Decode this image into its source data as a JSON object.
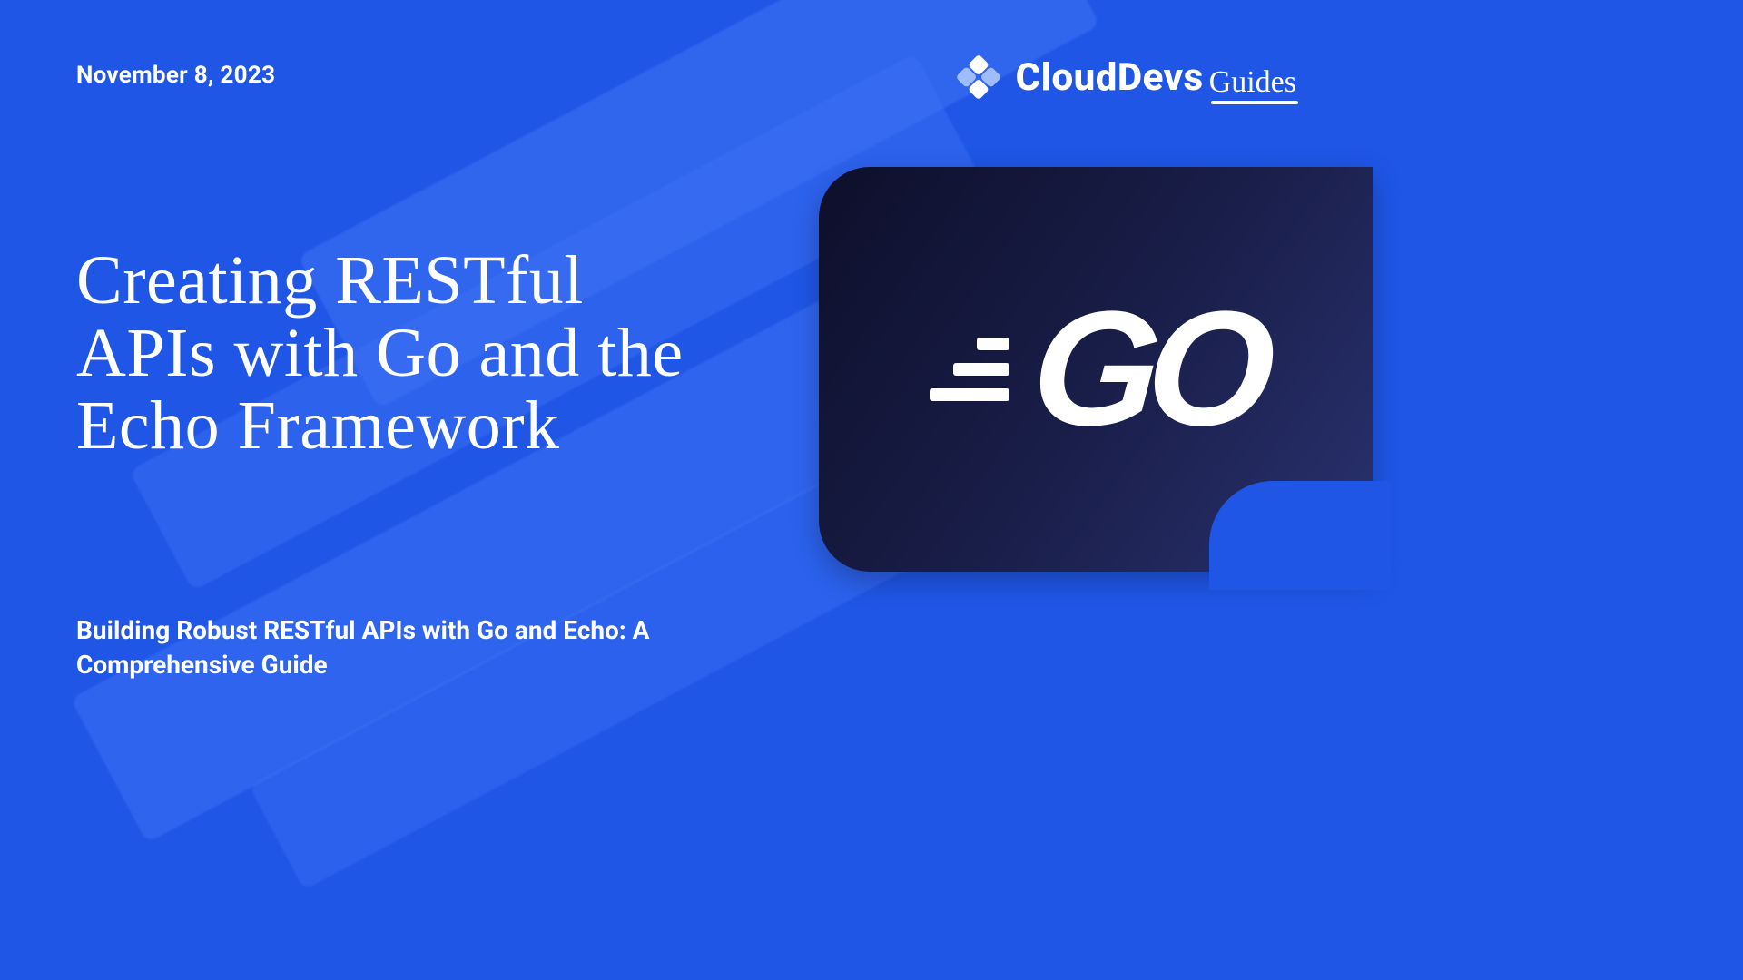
{
  "date": "November 8, 2023",
  "brand": {
    "main": "CloudDevs",
    "sub": "Guides"
  },
  "title": "Creating RESTful APIs with Go and the Echo Framework",
  "subtitle": "Building Robust RESTful APIs with Go and Echo: A Comprehensive Guide",
  "card": {
    "label": "GO"
  },
  "colors": {
    "page_bg": "#1f56e6",
    "streak": "#3f72f6",
    "card_gradient_from": "#0d0f2a",
    "card_gradient_to": "#2a3270",
    "text": "#ffffff"
  }
}
